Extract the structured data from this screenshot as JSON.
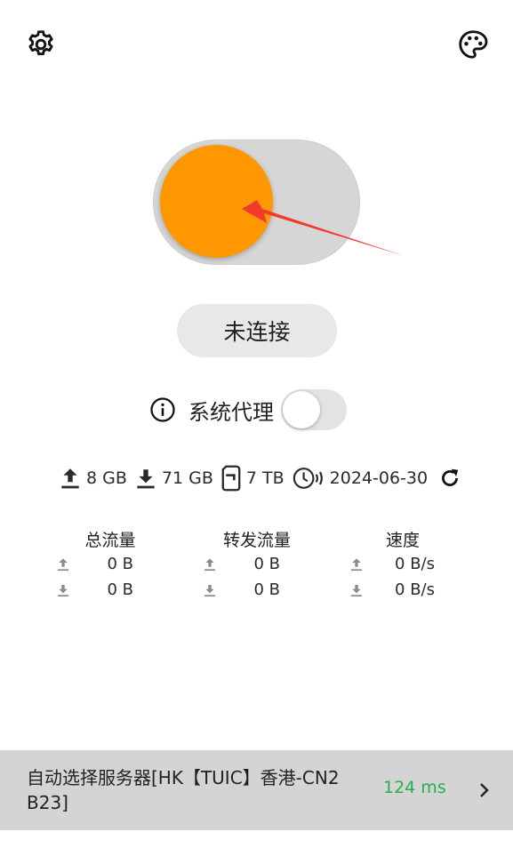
{
  "header": {
    "settings_icon": "gear-icon",
    "theme_icon": "palette-icon"
  },
  "connection": {
    "status_label": "未连接",
    "toggle_on": false,
    "knob_color": "#ff9800"
  },
  "system_proxy": {
    "label": "系统代理",
    "enabled": false,
    "info_icon": "info-icon"
  },
  "subscription": {
    "upload": "8 GB",
    "download": "71 GB",
    "total": "7 TB",
    "expire": "2024-06-30",
    "refresh_icon": "refresh-icon"
  },
  "stats": {
    "columns": [
      {
        "title": "总流量",
        "up": "0 B",
        "down": "0 B"
      },
      {
        "title": "转发流量",
        "up": "0 B",
        "down": "0 B"
      },
      {
        "title": "速度",
        "up": "0 B/s",
        "down": "0 B/s"
      }
    ]
  },
  "server": {
    "name": "自动选择服务器[HK【TUIC】香港-CN2 B23]",
    "latency": "124 ms",
    "latency_color": "#22b14c"
  },
  "annotation": {
    "arrow_color": "#f23b2f"
  }
}
